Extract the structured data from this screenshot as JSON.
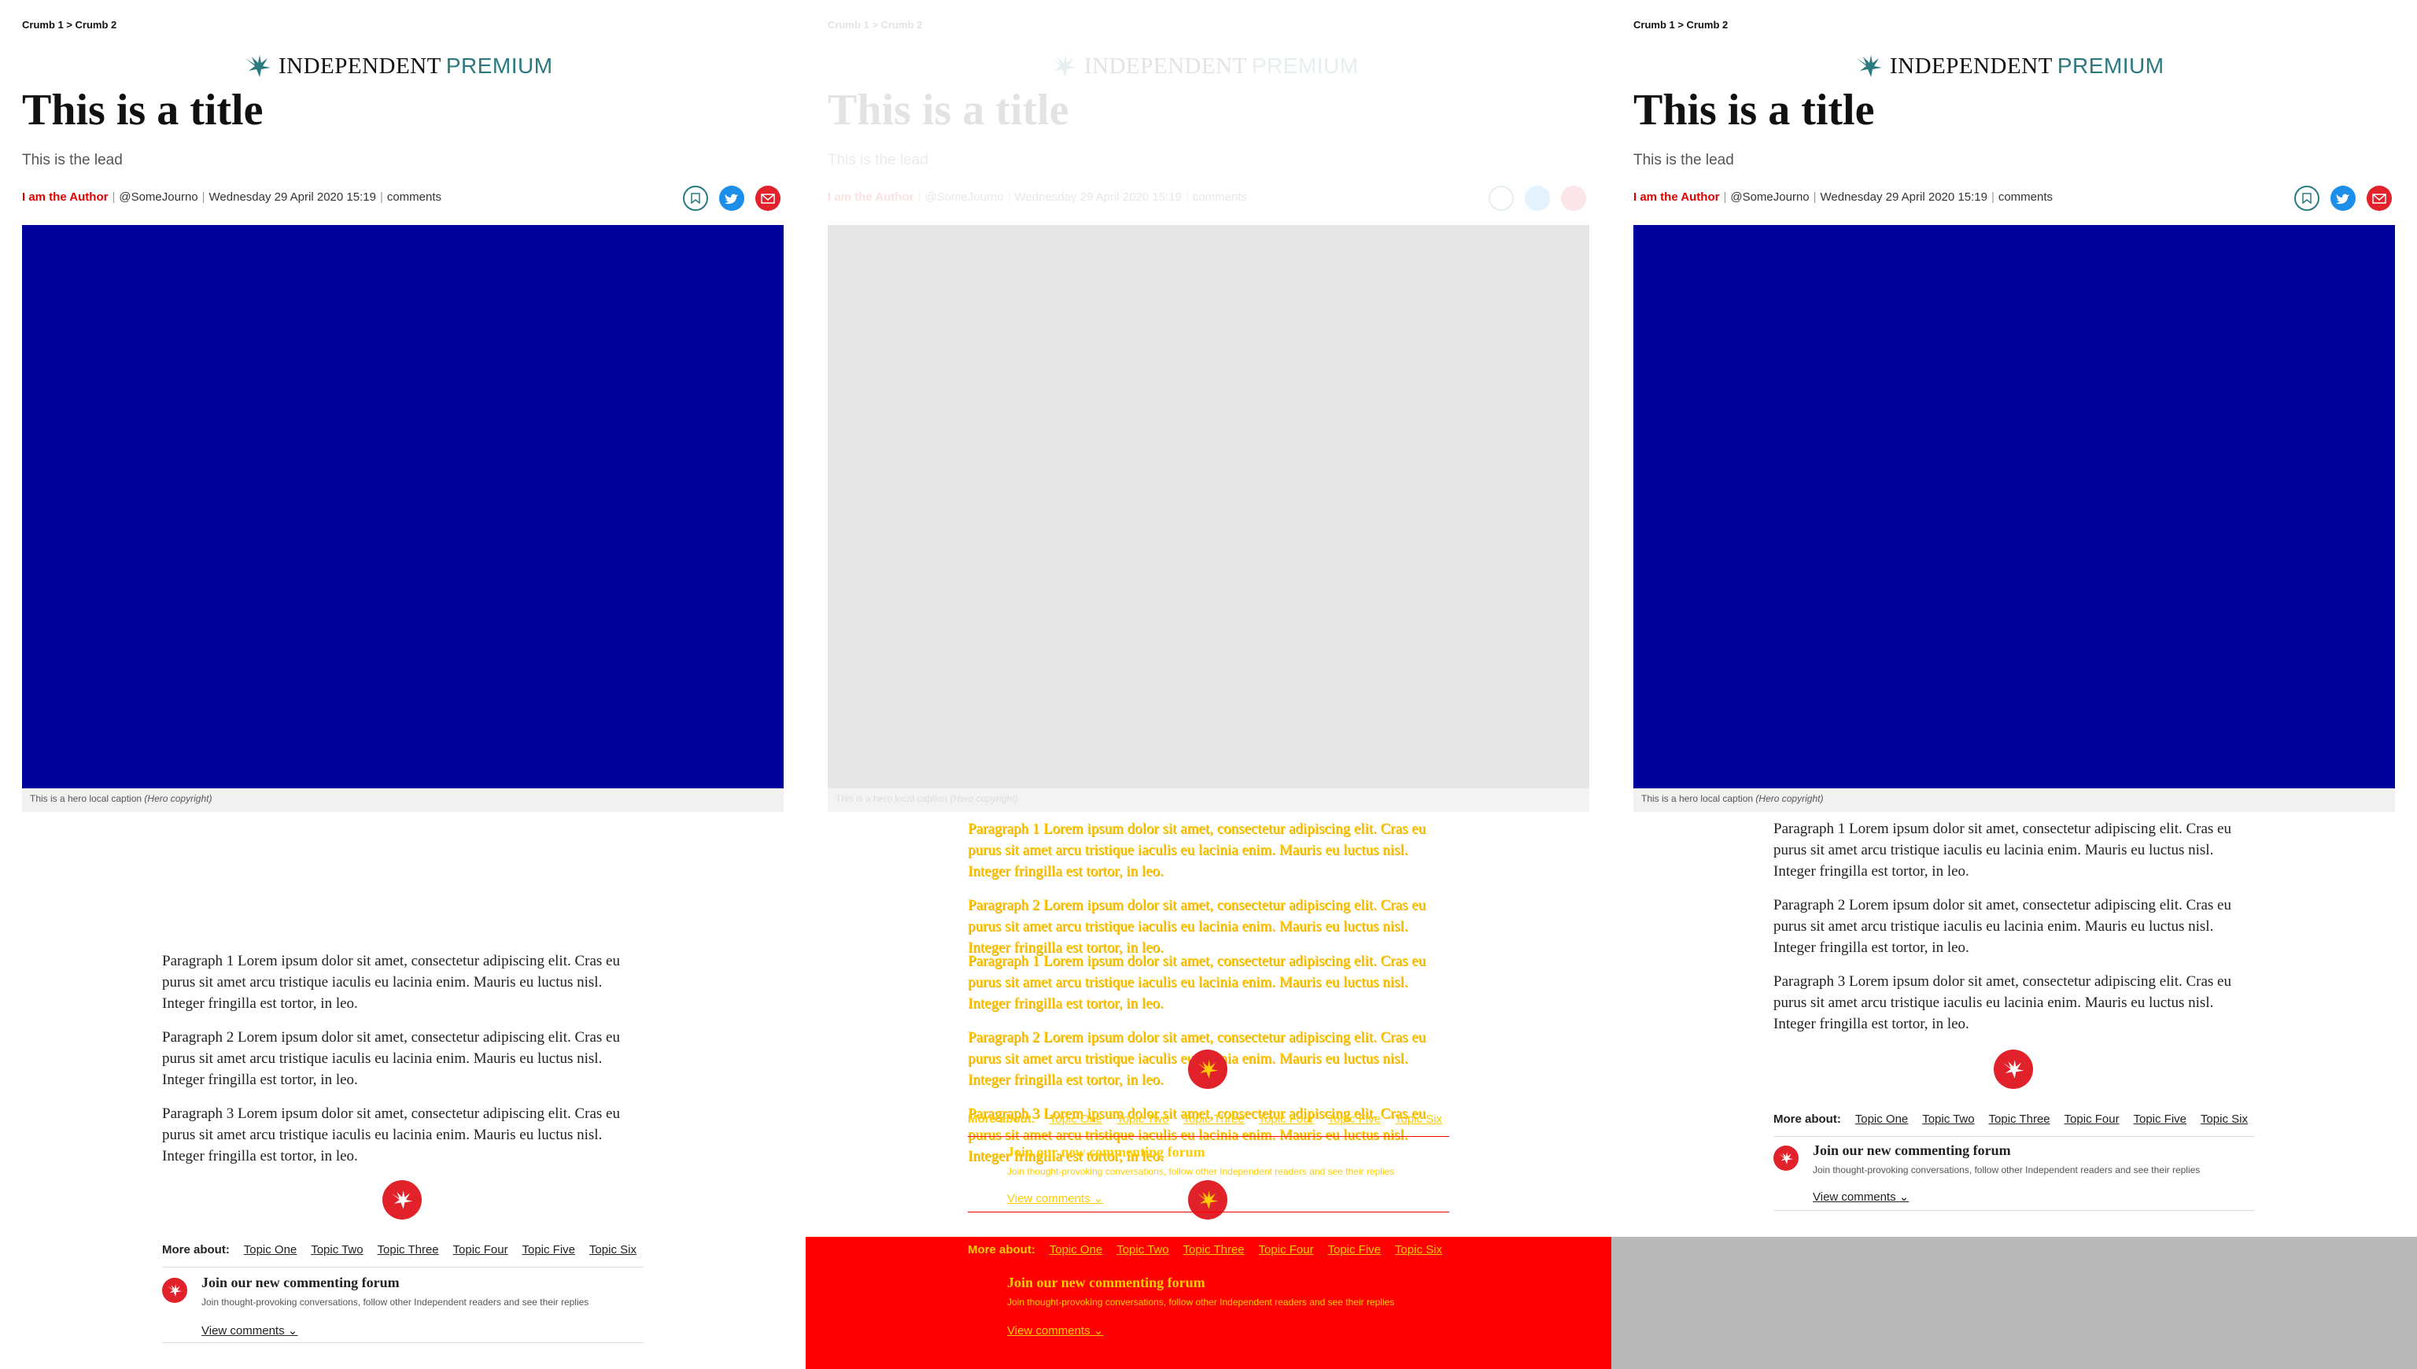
{
  "breadcrumb": "Crumb 1 > Crumb 2",
  "logo": {
    "main": "INDEPENDENT",
    "suffix": "PREMIUM"
  },
  "article": {
    "title": "This is a title",
    "lead": "This is the lead",
    "author": "I am the Author",
    "handle": "@SomeJourno",
    "date": "Wednesday 29 April 2020 15:19",
    "comments_label": "comments",
    "hero_caption": "This is a hero local caption",
    "hero_copyright": "(Hero copyright)",
    "paragraphs": [
      "Paragraph 1 Lorem ipsum dolor sit amet, consectetur adipiscing elit. Cras eu purus sit amet arcu tristique iaculis eu lacinia enim. Mauris eu luctus nisl. Integer fringilla est tortor, in leo.",
      "Paragraph 2 Lorem ipsum dolor sit amet, consectetur adipiscing elit. Cras eu purus sit amet arcu tristique iaculis eu lacinia enim. Mauris eu luctus nisl. Integer fringilla est tortor, in leo.",
      "Paragraph 3 Lorem ipsum dolor sit amet, consectetur adipiscing elit. Cras eu purus sit amet arcu tristique iaculis eu lacinia enim. Mauris eu luctus nisl. Integer fringilla est tortor, in leo."
    ]
  },
  "more_about": {
    "label": "More about:",
    "topics": [
      "Topic One",
      "Topic Two",
      "Topic Three",
      "Topic Four",
      "Topic Five",
      "Topic Six"
    ]
  },
  "forum": {
    "title": "Join our new commenting forum",
    "subtitle": "Join thought-provoking conversations, follow other Independent readers and see their replies",
    "view_comments": "View comments"
  },
  "colors": {
    "hero": "#00009a",
    "accent_red": "#e2222b",
    "brand_teal": "#2a7a80",
    "twitter_blue": "#1d8fe8",
    "diff_red": "#ff0000",
    "diff_yellow": "#ffcc00"
  },
  "icons": [
    "eagle-logo-icon",
    "bookmark-icon",
    "twitter-icon",
    "mail-icon",
    "eagle-emblem-icon",
    "chevron-down-icon"
  ]
}
